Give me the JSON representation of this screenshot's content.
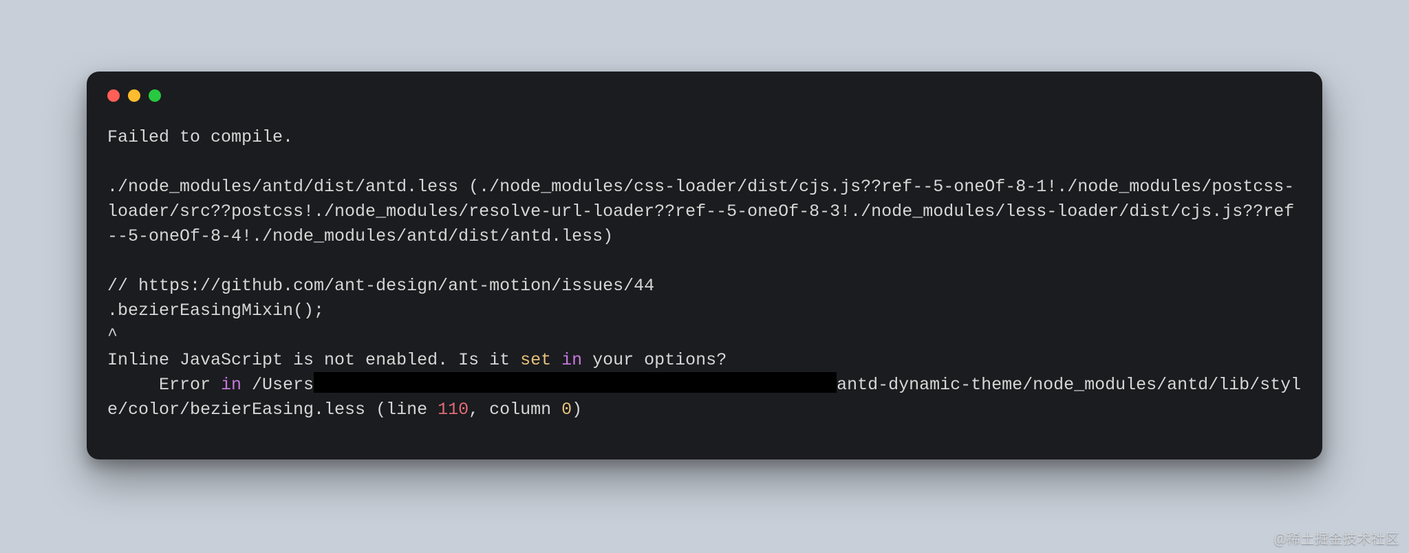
{
  "terminal": {
    "header": "Failed to compile.",
    "loader_chain": "./node_modules/antd/dist/antd.less (./node_modules/css-loader/dist/cjs.js??ref--5-oneOf-8-1!./node_modules/postcss-loader/src??postcss!./node_modules/resolve-url-loader??ref--5-oneOf-8-3!./node_modules/less-loader/dist/cjs.js??ref--5-oneOf-8-4!./node_modules/antd/dist/antd.less)",
    "comment_url": "// https://github.com/ant-design/ant-motion/issues/44",
    "mixin_call": ".bezierEasingMixin();",
    "caret": "^",
    "inline_js_msg_pre": "Inline JavaScript is not enabled. Is it ",
    "inline_js_set": "set",
    "inline_js_msg_mid": " ",
    "inline_js_in": "in",
    "inline_js_msg_post": " your options?",
    "error_pre": "Error ",
    "error_in": "in",
    "error_path_pre": " /Users",
    "error_path_post": "antd-dynamic-theme/node_modules/antd/lib/style/color/bezierEasing.less (line ",
    "error_line": "110",
    "error_mid": ", column ",
    "error_col": "0",
    "error_close": ")"
  },
  "watermark": "@稀土掘金技术社区"
}
